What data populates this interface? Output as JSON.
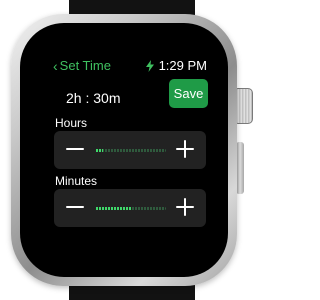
{
  "header": {
    "back_label": "Set Time",
    "time": "1:29 PM"
  },
  "summary": "2h : 30m",
  "save_label": "Save",
  "hours": {
    "label": "Hours",
    "level_fraction": 0.1
  },
  "minutes": {
    "label": "Minutes",
    "level_fraction": 0.5
  },
  "colors": {
    "accent": "#3fc060",
    "save_button": "#1f9b47",
    "stepper_background": "#222222",
    "level_fill": "#3fd86a"
  },
  "icons": {
    "back": "chevron-left-icon",
    "charging": "lightning-bolt-icon",
    "decrement": "minus-icon",
    "increment": "plus-icon"
  }
}
